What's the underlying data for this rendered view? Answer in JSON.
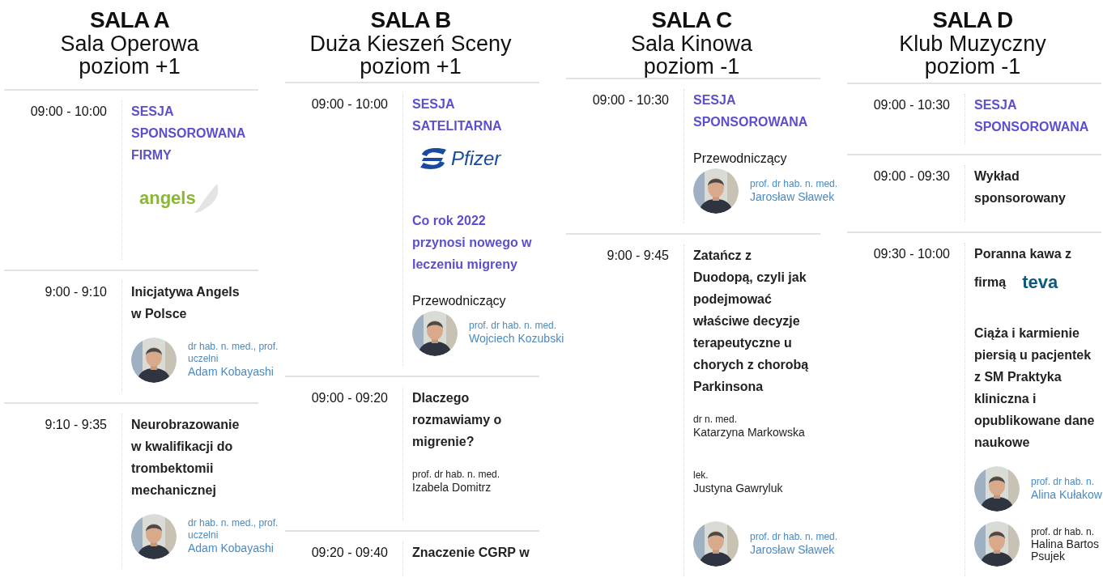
{
  "rooms": [
    {
      "code": "SALA A",
      "name": "Sala Operowa",
      "level_label": "poziom +1",
      "sessions": [
        {
          "time": "09:00 - 10:00",
          "blocks": [
            {
              "kind": "heading",
              "text": "SESJA SPONSOROWANA FIRMY"
            },
            {
              "kind": "logo_wing",
              "text": "angels"
            }
          ]
        },
        {
          "time": "9:00 - 9:10",
          "blocks": [
            {
              "kind": "title",
              "text": "Inicjatywa Angels w Polsce"
            },
            {
              "kind": "speaker",
              "degree": "dr hab. n. med., prof. uczelni",
              "name": "Adam Kobayashi"
            }
          ]
        },
        {
          "time": "9:10 - 9:35",
          "blocks": [
            {
              "kind": "title",
              "text": "Neurobrazowanie w kwalifikacji do trombektomii mechanicznej"
            },
            {
              "kind": "speaker",
              "degree": "dr hab. n. med., prof. uczelni",
              "name": "Adam Kobayashi"
            }
          ]
        }
      ]
    },
    {
      "code": "SALA B",
      "name": "Duża Kieszeń Sceny",
      "level_label": "poziom +1",
      "sessions": [
        {
          "time": "09:00 - 10:00",
          "blocks": [
            {
              "kind": "heading",
              "text": "SESJA SATELITARNA"
            },
            {
              "kind": "logo_swirl",
              "text": "Pfizer"
            },
            {
              "kind": "accent_title",
              "text": "Co rok 2022 przynosi nowego w leczeniu migreny"
            },
            {
              "kind": "label",
              "text": "Przewodniczący"
            },
            {
              "kind": "speaker",
              "degree": "prof. dr hab. n. med.",
              "name": "Wojciech Kozubski"
            }
          ]
        },
        {
          "time": "09:00 - 09:20",
          "blocks": [
            {
              "kind": "title",
              "text": "Dlaczego rozmawiamy o migrenie?"
            },
            {
              "kind": "plain_speaker",
              "degree": "prof. dr hab. n. med.",
              "name": "Izabela Domitrz"
            }
          ]
        },
        {
          "time": "09:20 - 09:40",
          "blocks": [
            {
              "kind": "title",
              "text": "Znaczenie CGRP w"
            }
          ]
        }
      ]
    },
    {
      "code": "SALA C",
      "name": "Sala Kinowa",
      "level_label": "poziom -1",
      "sessions": [
        {
          "time": "09:00 - 10:30",
          "blocks": [
            {
              "kind": "heading",
              "text": "SESJA SPONSOROWANA"
            },
            {
              "kind": "label",
              "text": "Przewodniczący"
            },
            {
              "kind": "speaker",
              "degree": "prof. dr hab. n. med.",
              "name": "Jarosław Sławek"
            }
          ]
        },
        {
          "time": "9:00 - 9:45",
          "blocks": [
            {
              "kind": "title",
              "text": "Zatańcz z Duodopą, czyli jak podejmować właściwe decyzje terapeutyczne u chorych z chorobą Parkinsona"
            },
            {
              "kind": "plain_speaker",
              "degree": "dr n. med.",
              "name": "Katarzyna Markowska"
            },
            {
              "kind": "plain_speaker",
              "degree": "lek.",
              "name": "Justyna Gawryluk"
            },
            {
              "kind": "speaker",
              "degree": "prof. dr hab. n. med.",
              "name": "Jarosław Sławek"
            }
          ]
        }
      ]
    },
    {
      "code": "SALA D",
      "name": "Klub Muzyczny",
      "level_label": "poziom -1",
      "sessions": [
        {
          "time": "09:00 - 10:30",
          "blocks": [
            {
              "kind": "heading",
              "text": "SESJA SPONSOROWANA"
            }
          ]
        },
        {
          "time": "09:00 - 09:30",
          "blocks": [
            {
              "kind": "title",
              "text": "Wykład sponsorowany"
            }
          ]
        },
        {
          "time": "09:30 - 10:00",
          "blocks": [
            {
              "kind": "title",
              "text": "Poranna kawa z"
            },
            {
              "kind": "inline_logo",
              "text": "firmą",
              "logo_text": "teva"
            },
            {
              "kind": "title",
              "text": "Ciąża i karmienie piersią u pacjentek z SM Praktyka kliniczna i opublikowane dane naukowe"
            },
            {
              "kind": "speaker",
              "degree": "prof. dr hab. n.",
              "name": "Alina Kułakow"
            },
            {
              "kind": "photo_speaker_plain",
              "degree": "prof. dr hab. n.",
              "name": "Halina Bartos Psujek"
            }
          ]
        }
      ]
    }
  ]
}
